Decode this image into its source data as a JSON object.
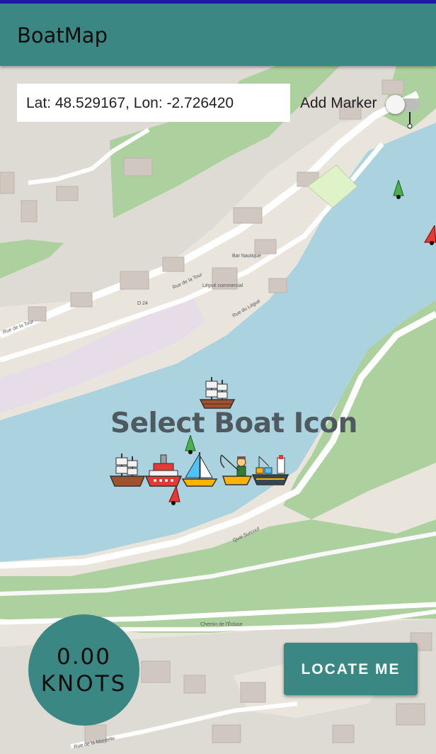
{
  "app": {
    "title": "BoatMap"
  },
  "coords": {
    "text": "Lat: 48.529167, Lon: -2.726420"
  },
  "marker_toggle": {
    "label": "Add Marker",
    "checked": false
  },
  "boat_picker": {
    "title": "Select Boat Icon",
    "selected_icon": "pirate-ship-icon",
    "options": [
      "pirate-ship-icon",
      "ferry-icon",
      "sailboat-icon",
      "fisherman-icon",
      "cargo-ship-icon"
    ]
  },
  "speed": {
    "value": "0.00",
    "unit": "KNOTS"
  },
  "locate": {
    "label": "LOCATE ME"
  },
  "map_labels": {
    "street1": "Rue de la Tour",
    "street2": "Rue de la Tour",
    "street3": "Quai Surcouf",
    "street4": "Chemin de l'Écluse",
    "street5": "Rue de la Mordelle",
    "street6": "Rue du Légué",
    "poi1": "Bar Nautique",
    "poi2": "Légué commercial",
    "road": "D 24"
  },
  "colors": {
    "primary": "#3b8783",
    "water": "#aad3df",
    "park": "#add19e",
    "status": "#1e1aa6"
  }
}
